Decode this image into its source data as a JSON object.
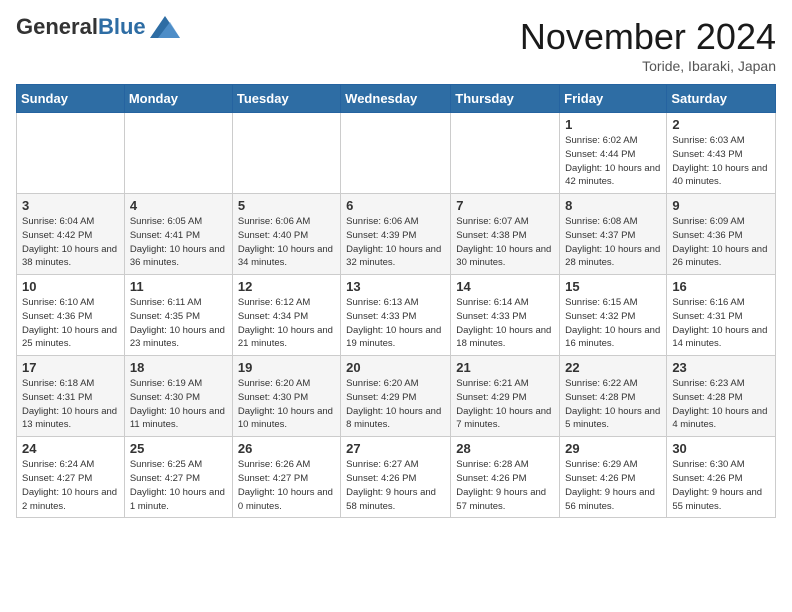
{
  "header": {
    "logo_general": "General",
    "logo_blue": "Blue",
    "month_title": "November 2024",
    "location": "Toride, Ibaraki, Japan"
  },
  "days_of_week": [
    "Sunday",
    "Monday",
    "Tuesday",
    "Wednesday",
    "Thursday",
    "Friday",
    "Saturday"
  ],
  "weeks": [
    [
      {
        "day": "",
        "info": ""
      },
      {
        "day": "",
        "info": ""
      },
      {
        "day": "",
        "info": ""
      },
      {
        "day": "",
        "info": ""
      },
      {
        "day": "",
        "info": ""
      },
      {
        "day": "1",
        "info": "Sunrise: 6:02 AM\nSunset: 4:44 PM\nDaylight: 10 hours and 42 minutes."
      },
      {
        "day": "2",
        "info": "Sunrise: 6:03 AM\nSunset: 4:43 PM\nDaylight: 10 hours and 40 minutes."
      }
    ],
    [
      {
        "day": "3",
        "info": "Sunrise: 6:04 AM\nSunset: 4:42 PM\nDaylight: 10 hours and 38 minutes."
      },
      {
        "day": "4",
        "info": "Sunrise: 6:05 AM\nSunset: 4:41 PM\nDaylight: 10 hours and 36 minutes."
      },
      {
        "day": "5",
        "info": "Sunrise: 6:06 AM\nSunset: 4:40 PM\nDaylight: 10 hours and 34 minutes."
      },
      {
        "day": "6",
        "info": "Sunrise: 6:06 AM\nSunset: 4:39 PM\nDaylight: 10 hours and 32 minutes."
      },
      {
        "day": "7",
        "info": "Sunrise: 6:07 AM\nSunset: 4:38 PM\nDaylight: 10 hours and 30 minutes."
      },
      {
        "day": "8",
        "info": "Sunrise: 6:08 AM\nSunset: 4:37 PM\nDaylight: 10 hours and 28 minutes."
      },
      {
        "day": "9",
        "info": "Sunrise: 6:09 AM\nSunset: 4:36 PM\nDaylight: 10 hours and 26 minutes."
      }
    ],
    [
      {
        "day": "10",
        "info": "Sunrise: 6:10 AM\nSunset: 4:36 PM\nDaylight: 10 hours and 25 minutes."
      },
      {
        "day": "11",
        "info": "Sunrise: 6:11 AM\nSunset: 4:35 PM\nDaylight: 10 hours and 23 minutes."
      },
      {
        "day": "12",
        "info": "Sunrise: 6:12 AM\nSunset: 4:34 PM\nDaylight: 10 hours and 21 minutes."
      },
      {
        "day": "13",
        "info": "Sunrise: 6:13 AM\nSunset: 4:33 PM\nDaylight: 10 hours and 19 minutes."
      },
      {
        "day": "14",
        "info": "Sunrise: 6:14 AM\nSunset: 4:33 PM\nDaylight: 10 hours and 18 minutes."
      },
      {
        "day": "15",
        "info": "Sunrise: 6:15 AM\nSunset: 4:32 PM\nDaylight: 10 hours and 16 minutes."
      },
      {
        "day": "16",
        "info": "Sunrise: 6:16 AM\nSunset: 4:31 PM\nDaylight: 10 hours and 14 minutes."
      }
    ],
    [
      {
        "day": "17",
        "info": "Sunrise: 6:18 AM\nSunset: 4:31 PM\nDaylight: 10 hours and 13 minutes."
      },
      {
        "day": "18",
        "info": "Sunrise: 6:19 AM\nSunset: 4:30 PM\nDaylight: 10 hours and 11 minutes."
      },
      {
        "day": "19",
        "info": "Sunrise: 6:20 AM\nSunset: 4:30 PM\nDaylight: 10 hours and 10 minutes."
      },
      {
        "day": "20",
        "info": "Sunrise: 6:20 AM\nSunset: 4:29 PM\nDaylight: 10 hours and 8 minutes."
      },
      {
        "day": "21",
        "info": "Sunrise: 6:21 AM\nSunset: 4:29 PM\nDaylight: 10 hours and 7 minutes."
      },
      {
        "day": "22",
        "info": "Sunrise: 6:22 AM\nSunset: 4:28 PM\nDaylight: 10 hours and 5 minutes."
      },
      {
        "day": "23",
        "info": "Sunrise: 6:23 AM\nSunset: 4:28 PM\nDaylight: 10 hours and 4 minutes."
      }
    ],
    [
      {
        "day": "24",
        "info": "Sunrise: 6:24 AM\nSunset: 4:27 PM\nDaylight: 10 hours and 2 minutes."
      },
      {
        "day": "25",
        "info": "Sunrise: 6:25 AM\nSunset: 4:27 PM\nDaylight: 10 hours and 1 minute."
      },
      {
        "day": "26",
        "info": "Sunrise: 6:26 AM\nSunset: 4:27 PM\nDaylight: 10 hours and 0 minutes."
      },
      {
        "day": "27",
        "info": "Sunrise: 6:27 AM\nSunset: 4:26 PM\nDaylight: 9 hours and 58 minutes."
      },
      {
        "day": "28",
        "info": "Sunrise: 6:28 AM\nSunset: 4:26 PM\nDaylight: 9 hours and 57 minutes."
      },
      {
        "day": "29",
        "info": "Sunrise: 6:29 AM\nSunset: 4:26 PM\nDaylight: 9 hours and 56 minutes."
      },
      {
        "day": "30",
        "info": "Sunrise: 6:30 AM\nSunset: 4:26 PM\nDaylight: 9 hours and 55 minutes."
      }
    ]
  ]
}
